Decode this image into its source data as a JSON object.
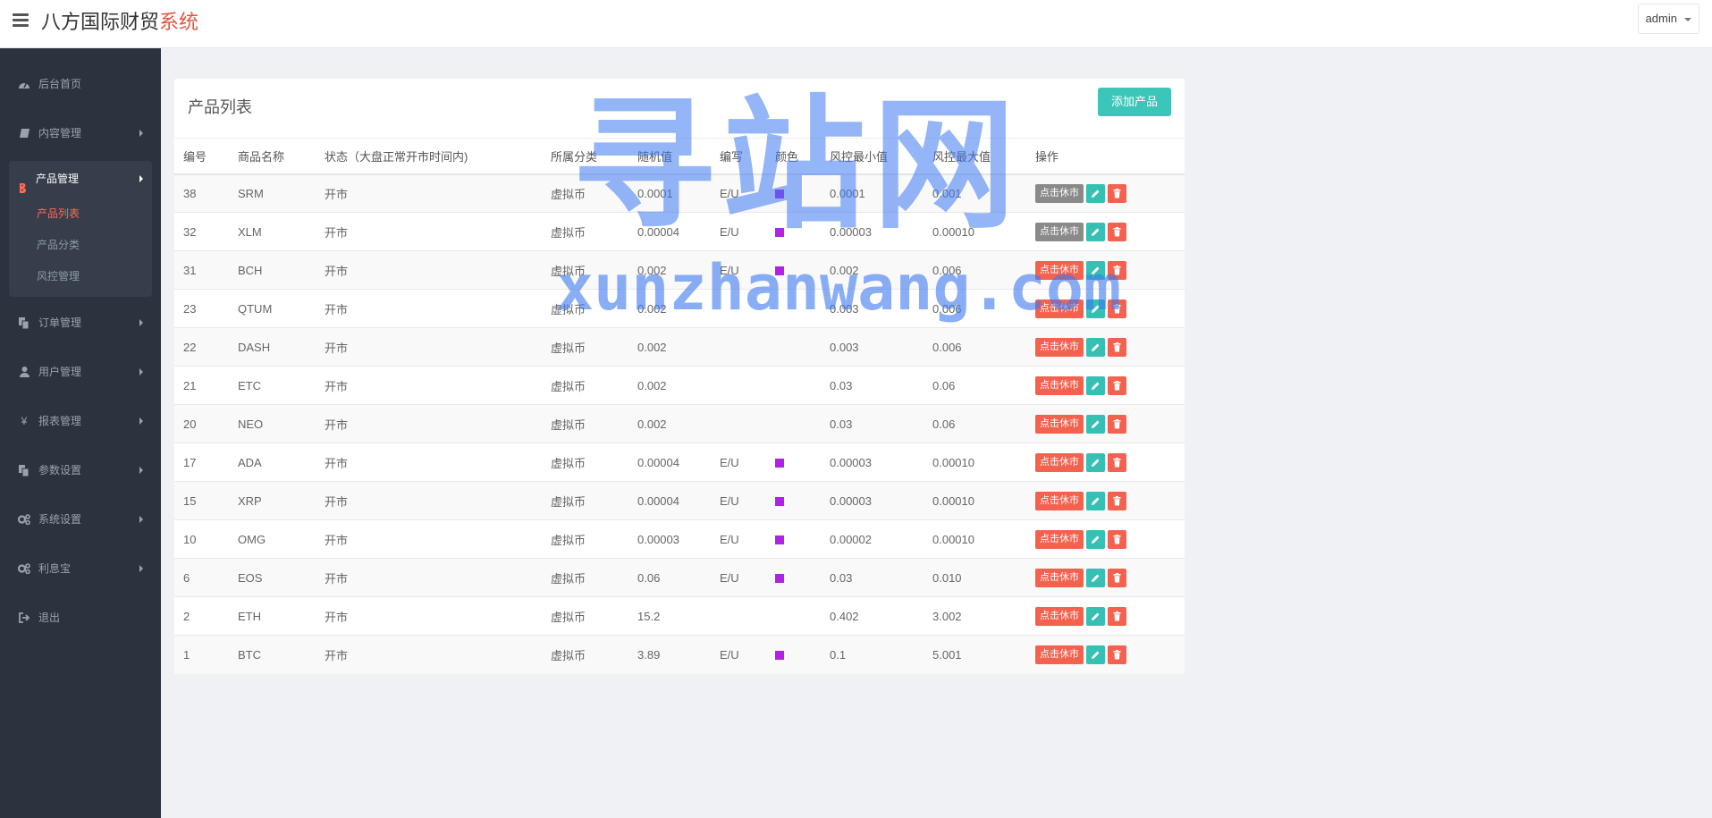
{
  "header": {
    "brand_main": "八方国际财贸",
    "brand_accent": "系统",
    "user": "admin"
  },
  "sidebar": {
    "items": [
      {
        "label": "后台首页",
        "icon": "dashboard-icon"
      },
      {
        "label": "内容管理",
        "icon": "book-icon"
      },
      {
        "label": "订单管理",
        "icon": "copy-icon"
      },
      {
        "label": "用户管理",
        "icon": "user-icon"
      },
      {
        "label": "报表管理",
        "icon": "yen-icon"
      },
      {
        "label": "参数设置",
        "icon": "copy-icon"
      },
      {
        "label": "系统设置",
        "icon": "gears-icon"
      },
      {
        "label": "利息宝",
        "icon": "gears-icon"
      },
      {
        "label": "退出",
        "icon": "sign-out-icon"
      }
    ],
    "active_group": {
      "label": "产品管理",
      "icon": "bitcoin-icon",
      "subitems": [
        {
          "label": "产品列表",
          "active": true
        },
        {
          "label": "产品分类",
          "active": false
        },
        {
          "label": "风控管理",
          "active": false
        }
      ]
    }
  },
  "panel": {
    "title": "产品列表",
    "add_button": "添加产品",
    "columns": [
      "编号",
      "商品名称",
      "状态（大盘正常开市时间内)",
      "所属分类",
      "随机值",
      "编写",
      "颜色",
      "风控最小值",
      "风控最大值",
      "操作"
    ],
    "halt_label": "点击休市",
    "rows": [
      {
        "id": "38",
        "name": "SRM",
        "status": "开市",
        "category": "虚拟币",
        "random": "0.0001",
        "code": "E/U",
        "color": "#b022e6",
        "min": "0.0001",
        "max": "0.001",
        "halt_dim": true
      },
      {
        "id": "32",
        "name": "XLM",
        "status": "开市",
        "category": "虚拟币",
        "random": "0.00004",
        "code": "E/U",
        "color": "#b022e6",
        "min": "0.00003",
        "max": "0.00010",
        "halt_dim": true
      },
      {
        "id": "31",
        "name": "BCH",
        "status": "开市",
        "category": "虚拟币",
        "random": "0.002",
        "code": "E/U",
        "color": "#b022e6",
        "min": "0.002",
        "max": "0.006",
        "halt_dim": false
      },
      {
        "id": "23",
        "name": "QTUM",
        "status": "开市",
        "category": "虚拟币",
        "random": "0.002",
        "code": "",
        "color": "",
        "min": "0.003",
        "max": "0.006",
        "halt_dim": false
      },
      {
        "id": "22",
        "name": "DASH",
        "status": "开市",
        "category": "虚拟币",
        "random": "0.002",
        "code": "",
        "color": "",
        "min": "0.003",
        "max": "0.006",
        "halt_dim": false
      },
      {
        "id": "21",
        "name": "ETC",
        "status": "开市",
        "category": "虚拟币",
        "random": "0.002",
        "code": "",
        "color": "",
        "min": "0.03",
        "max": "0.06",
        "halt_dim": false
      },
      {
        "id": "20",
        "name": "NEO",
        "status": "开市",
        "category": "虚拟币",
        "random": "0.002",
        "code": "",
        "color": "",
        "min": "0.03",
        "max": "0.06",
        "halt_dim": false
      },
      {
        "id": "17",
        "name": "ADA",
        "status": "开市",
        "category": "虚拟币",
        "random": "0.00004",
        "code": "E/U",
        "color": "#b022e6",
        "min": "0.00003",
        "max": "0.00010",
        "halt_dim": false
      },
      {
        "id": "15",
        "name": "XRP",
        "status": "开市",
        "category": "虚拟币",
        "random": "0.00004",
        "code": "E/U",
        "color": "#b022e6",
        "min": "0.00003",
        "max": "0.00010",
        "halt_dim": false
      },
      {
        "id": "10",
        "name": "OMG",
        "status": "开市",
        "category": "虚拟币",
        "random": "0.00003",
        "code": "E/U",
        "color": "#b022e6",
        "min": "0.00002",
        "max": "0.00010",
        "halt_dim": false
      },
      {
        "id": "6",
        "name": "EOS",
        "status": "开市",
        "category": "虚拟币",
        "random": "0.06",
        "code": "E/U",
        "color": "#b022e6",
        "min": "0.03",
        "max": "0.010",
        "halt_dim": false
      },
      {
        "id": "2",
        "name": "ETH",
        "status": "开市",
        "category": "虚拟币",
        "random": "15.2",
        "code": "",
        "color": "",
        "min": "0.402",
        "max": "3.002",
        "halt_dim": false
      },
      {
        "id": "1",
        "name": "BTC",
        "status": "开市",
        "category": "虚拟币",
        "random": "3.89",
        "code": "E/U",
        "color": "#b022e6",
        "min": "0.1",
        "max": "5.001",
        "halt_dim": false
      }
    ]
  },
  "watermark": {
    "big": "寻站网",
    "small": "xunzhanwang.com"
  }
}
